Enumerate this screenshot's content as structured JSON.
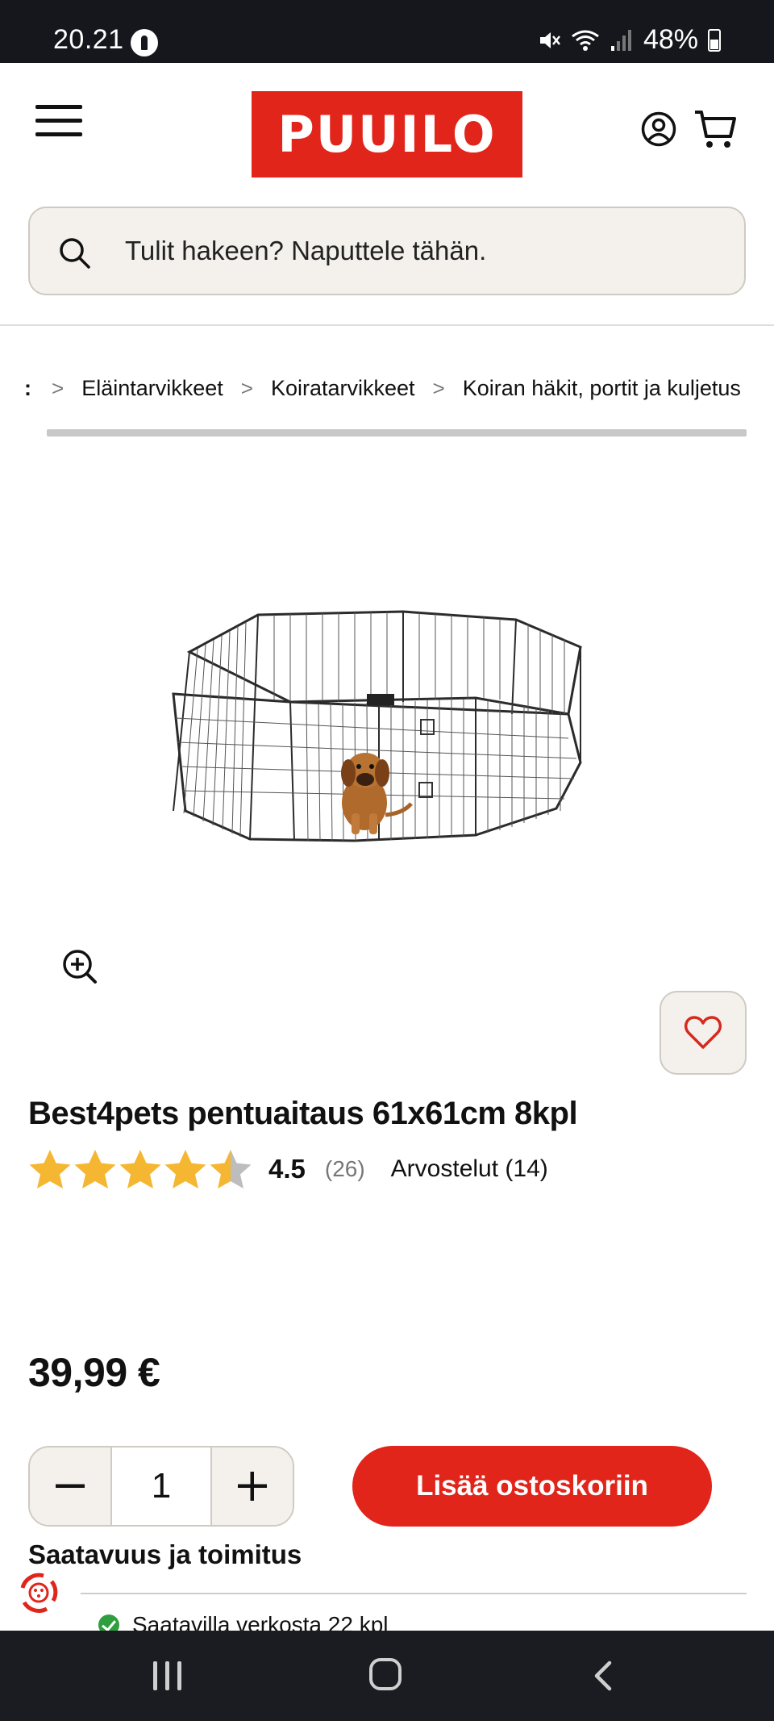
{
  "status_bar": {
    "time": "20.21",
    "battery": "48%"
  },
  "header": {
    "logo_text": "PUUILO",
    "icons": [
      "menu-icon",
      "account-icon",
      "cart-icon"
    ]
  },
  "search": {
    "placeholder": "Tulit hakeen? Naputtele tähän."
  },
  "breadcrumb": {
    "items": [
      "Eläintarvikkeet",
      "Koiratarvikkeet",
      "Koiran häkit, portit ja kuljetus"
    ]
  },
  "product": {
    "title": "Best4pets pentuaitaus 61x61cm 8kpl",
    "rating": "4.5",
    "rating_value": 4.5,
    "rating_count": "(26)",
    "reviews_label": "Arvostelut (14)",
    "price": "39,99 €",
    "quantity": "1",
    "add_to_cart": "Lisää ostoskoriin"
  },
  "availability": {
    "title": "Saatavuus ja toimitus",
    "online": "Saatavilla verkosta 22 kpl"
  },
  "colors": {
    "brand_red": "#e1251b",
    "star_gold": "#f5b731",
    "star_empty": "#bdbdbd",
    "available_green": "#2e9e3e"
  }
}
